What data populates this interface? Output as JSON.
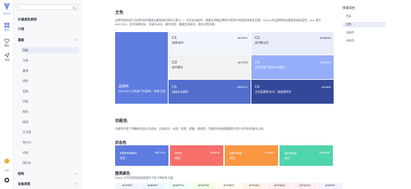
{
  "app": {
    "logo_text": "DevUI",
    "brand_color": "#5e7ce0"
  },
  "rail": {
    "items": [
      {
        "label": "组件",
        "icon": "grid-icon"
      },
      {
        "label": "图标",
        "icon": "heart-icon"
      },
      {
        "label": "资源",
        "icon": "paper-plane-icon"
      }
    ],
    "bottom": {
      "lang": "EN",
      "theme_icon": "palette-icon",
      "github_icon": "github-icon"
    }
  },
  "sidebar": {
    "search_placeholder": "",
    "items": [
      {
        "label": "价值观及原则",
        "type": "group"
      },
      {
        "label": "介绍",
        "type": "group"
      },
      {
        "label": "基础",
        "type": "group-open"
      },
      {
        "label": "色彩",
        "type": "sub-active"
      },
      {
        "label": "字体",
        "type": "sub"
      },
      {
        "label": "圆角",
        "type": "sub"
      },
      {
        "label": "阴影",
        "type": "sub"
      },
      {
        "label": "层级",
        "type": "sub"
      },
      {
        "label": "间距",
        "type": "sub"
      },
      {
        "label": "图标",
        "type": "sub"
      },
      {
        "label": "插画",
        "type": "sub"
      },
      {
        "label": "空页面",
        "type": "sub"
      },
      {
        "label": "响应式",
        "type": "sub"
      },
      {
        "label": "动效",
        "type": "sub"
      },
      {
        "label": "国际化",
        "type": "sub"
      },
      {
        "label": "结构",
        "type": "group"
      },
      {
        "label": "设备类型",
        "type": "group-open"
      }
    ]
  },
  "main": {
    "section_title": "主色",
    "intro": "品牌色即体现产品特性和传播理念最直观的视觉元素之一。在色彩选取时，需要先明确品牌色在界面中的使用场景及范围。DevUI 的品牌色取自基础色板的蓝色，Hex 值为 #5E7CE0，应用场景包括：关键行动点、操作状态、重要信息高亮、图形化等场景。",
    "primary": {
      "name": "品牌色",
      "code_line": "#5E7CE0",
      "desc": "主色调/下拉菜单，选择/已选"
    },
    "swatches": [
      {
        "name": "C1",
        "code": "#F2F5FC",
        "desc": "选择/选中",
        "color": "#F2F5FC",
        "text_color": "#252b3a"
      },
      {
        "name": "C2",
        "code": "#E9EDFA",
        "desc": "选中默认色",
        "color": "#E9EDFA",
        "text_color": "#252b3a"
      },
      {
        "name": "C3",
        "code": "#F2F2F3",
        "desc": "选中悬浮",
        "color": "#F2F2F3",
        "text_color": "#252b3a"
      },
      {
        "name": "C4",
        "code": "#96ADFA",
        "desc": "深色背景下链接文本颜色",
        "color": "#96ADFA",
        "text_color": "#ffffff"
      },
      {
        "name": "C5",
        "code": "#526ECC",
        "desc": "链接文本颜色",
        "color": "#526ECC",
        "text_color": "#ffffff"
      },
      {
        "name": "C6",
        "code": "#344899",
        "desc": "主色蓝悬停/文字、链接悬停色",
        "color": "#344899",
        "text_color": "#ffffff"
      }
    ],
    "functional_title": "功能色",
    "functional_intro": "功能色代表了明确的信息以及状态，比如成功、出错、失败、提醒、链接等。功能色的选取需要遵守用户对色彩的基本认知。",
    "status_title": "状态色",
    "status": [
      {
        "name": "information",
        "desc": "信息",
        "code": "#5E7CE0",
        "color": "#5E7CE0"
      },
      {
        "name": "error",
        "desc": "错误",
        "code": "#F66F6A",
        "color": "#F66F6A"
      },
      {
        "name": "warning",
        "desc": "警告",
        "code": "#FA9841",
        "color": "#FA9841"
      },
      {
        "name": "success",
        "desc": "成功",
        "code": "#50D4AB",
        "color": "#50D4AB"
      }
    ],
    "chart_title": "图表颜色",
    "chart_intro": "DevUI 为不同类型的图表提供了若干种配色方案。",
    "chips": [
      {
        "code": "#F2F5FC",
        "color": "#F2F5FC"
      },
      {
        "code": "#EBF6FF",
        "color": "#EBF6FF"
      },
      {
        "code": "#EDFFF9",
        "color": "#EDFFF9"
      },
      {
        "code": "#FOFFE6",
        "color": "#F0FFE6"
      },
      {
        "code": "#FFFBF0",
        "color": "#FFFBF0"
      },
      {
        "code": "#FFF3E8",
        "color": "#FFF3E8"
      },
      {
        "code": "#FFEEED",
        "color": "#FFEEED"
      },
      {
        "code": "#FFEDF3",
        "color": "#FFEDF3"
      },
      {
        "code": "#F5F0FF",
        "color": "#F5F0FF"
      }
    ]
  },
  "toc": {
    "title": "快速前往",
    "items": [
      {
        "label": "色彩",
        "active": false
      },
      {
        "label": "主色",
        "active": true
      },
      {
        "label": "功能色",
        "active": false
      },
      {
        "label": "中性色",
        "active": false
      }
    ]
  }
}
